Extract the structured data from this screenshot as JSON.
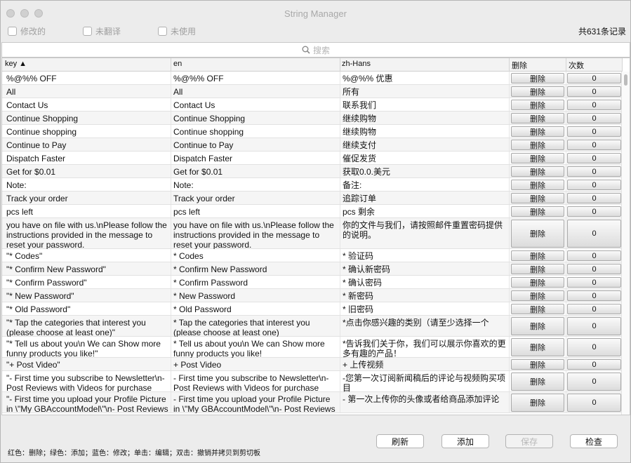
{
  "window": {
    "title": "String Manager"
  },
  "filters": [
    {
      "label": "修改的"
    },
    {
      "label": "未翻译"
    },
    {
      "label": "未使用"
    }
  ],
  "record_count": "共631条记录",
  "search": {
    "placeholder": "搜索"
  },
  "columns": {
    "key": "key ▲",
    "en": "en",
    "zh": "zh-Hans",
    "delete": "删除",
    "count": "次数"
  },
  "rows": [
    {
      "key": " %@%% OFF",
      "en": "%@%% OFF",
      "zh": "%@%% 优惠",
      "del": "删除",
      "count": "0"
    },
    {
      "key": "All",
      "en": "All",
      "zh": "所有",
      "del": "删除",
      "count": "0"
    },
    {
      "key": "Contact Us",
      "en": "Contact Us",
      "zh": "联系我们",
      "del": "删除",
      "count": "0"
    },
    {
      "key": "Continue Shopping",
      "en": "Continue Shopping",
      "zh": "继续购物",
      "del": "删除",
      "count": "0"
    },
    {
      "key": "Continue shopping",
      "en": "Continue shopping",
      "zh": "继续购物",
      "del": "删除",
      "count": "0"
    },
    {
      "key": "Continue to Pay",
      "en": "Continue to Pay",
      "zh": "继续支付",
      "del": "删除",
      "count": "0"
    },
    {
      "key": "Dispatch Faster",
      "en": "Dispatch Faster",
      "zh": "催促发货",
      "del": "删除",
      "count": "0"
    },
    {
      "key": "Get for $0.01",
      "en": "Get for $0.01",
      "zh": "获取0.0.美元",
      "del": "删除",
      "count": "0"
    },
    {
      "key": "Note:",
      "en": "Note:",
      "zh": "备注:",
      "del": "删除",
      "count": "0"
    },
    {
      "key": "Track your order",
      "en": "Track your order",
      "zh": "追踪订单",
      "del": "删除",
      "count": "0"
    },
    {
      "key": "pcs left",
      "en": "pcs left",
      "zh": "pcs 剩余",
      "del": "删除",
      "count": "0"
    },
    {
      "key": " you have on file with us.\\nPlease follow the instructions provided in the message to reset your password.",
      "en": " you have on file with us.\\nPlease follow the instructions provided in the message to reset your password.",
      "zh": "你的文件与我们，请按照邮件重置密码提供的说明。",
      "del": "删除",
      "count": "0"
    },
    {
      "key": "\"* Codes\"",
      "en": "* Codes",
      "zh": "* 验证码",
      "del": "删除",
      "count": "0"
    },
    {
      "key": "\"* Confirm New Password\"",
      "en": "* Confirm New Password",
      "zh": "* 确认新密码",
      "del": "删除",
      "count": "0"
    },
    {
      "key": "\"* Confirm Password\"",
      "en": "* Confirm Password",
      "zh": "* 确认密码",
      "del": "删除",
      "count": "0"
    },
    {
      "key": "\"* New Password\"",
      "en": "* New Password",
      "zh": "* 新密码",
      "del": "删除",
      "count": "0"
    },
    {
      "key": "\"* Old Password\"",
      "en": "* Old Password",
      "zh": "* 旧密码",
      "del": "删除",
      "count": "0"
    },
    {
      "key": "\"* Tap the categories that interest you (please choose at least one)\"",
      "en": "* Tap the categories that interest you (please choose at least one)",
      "zh": "*点击你感兴趣的类别（请至少选择一个",
      "del": "删除",
      "count": "0"
    },
    {
      "key": "\"* Tell us about you\\n   We can Show more funny products you like!\"",
      "en": "* Tell us about you\\n   We can Show more funny products you like!",
      "zh": "*告诉我们关于你，我们可以展示你喜欢的更多有趣的产品！",
      "del": "删除",
      "count": "0"
    },
    {
      "key": "\"+ Post Video\"",
      "en": "+ Post Video",
      "zh": "+ 上传视频",
      "del": "删除",
      "count": "0"
    },
    {
      "key": "\"- First time you subscribe to Newsletter\\n- Post Reviews with Videos for purchase",
      "en": "- First time you subscribe to Newsletter\\n- Post Reviews with Videos for purchase",
      "zh": "-您第一次订阅新闻稿后的评论与视频购买项目",
      "del": "删除",
      "count": "0"
    },
    {
      "key": "\"- First time you upload your Profile Picture in \\\"My GBAccountModel\\\"\\n- Post Reviews",
      "en": "- First time you upload your Profile Picture in \\\"My GBAccountModel\\\"\\n- Post Reviews",
      "zh": "- 第一次上传你的头像或者给商品添加评论",
      "del": "删除",
      "count": "0"
    }
  ],
  "legend": "红色：删除；绿色：添加；蓝色：修改；单击：编辑；双击：撤销并拷贝到剪切板",
  "buttons": {
    "refresh": "刷新",
    "add": "添加",
    "save": "保存",
    "check": "检查"
  }
}
